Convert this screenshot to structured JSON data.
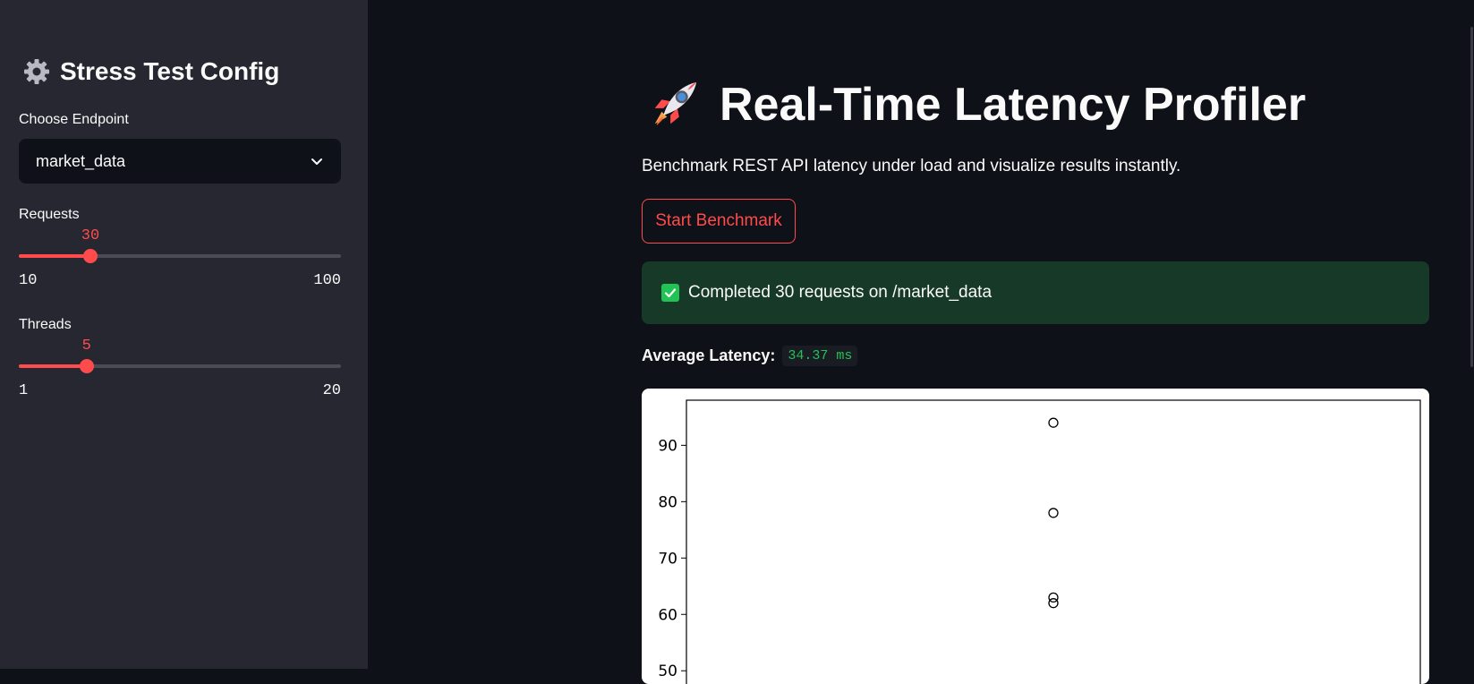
{
  "sidebar": {
    "title": "Stress Test Config",
    "title_icon": "gear-icon",
    "endpoint": {
      "label": "Choose Endpoint",
      "selected": "market_data"
    },
    "requests": {
      "label": "Requests",
      "value": 30,
      "value_text": "30",
      "min": 10,
      "max": 100,
      "min_text": "10",
      "max_text": "100"
    },
    "threads": {
      "label": "Threads",
      "value": 5,
      "value_text": "5",
      "min": 1,
      "max": 20,
      "min_text": "1",
      "max_text": "20"
    }
  },
  "main": {
    "title": "Real-Time Latency Profiler",
    "title_icon": "rocket-icon",
    "subtitle": "Benchmark REST API latency under load and visualize results instantly.",
    "start_button": "Start Benchmark",
    "success": "Completed 30 requests on /market_data",
    "metric": {
      "label": "Average Latency:",
      "value": "34.37 ms"
    }
  },
  "colors": {
    "accent": "#ff4b4b",
    "success": "#21c354",
    "background": "#0e1117",
    "sidebar": "#262730"
  },
  "chart_data": {
    "type": "scatter",
    "title": "",
    "xlabel": "",
    "ylabel": "",
    "y_ticks": [
      "50",
      "60",
      "70",
      "80",
      "90"
    ],
    "ylim": [
      44,
      98
    ],
    "points": [
      94,
      78,
      63,
      62
    ],
    "marker": "open-circle"
  }
}
